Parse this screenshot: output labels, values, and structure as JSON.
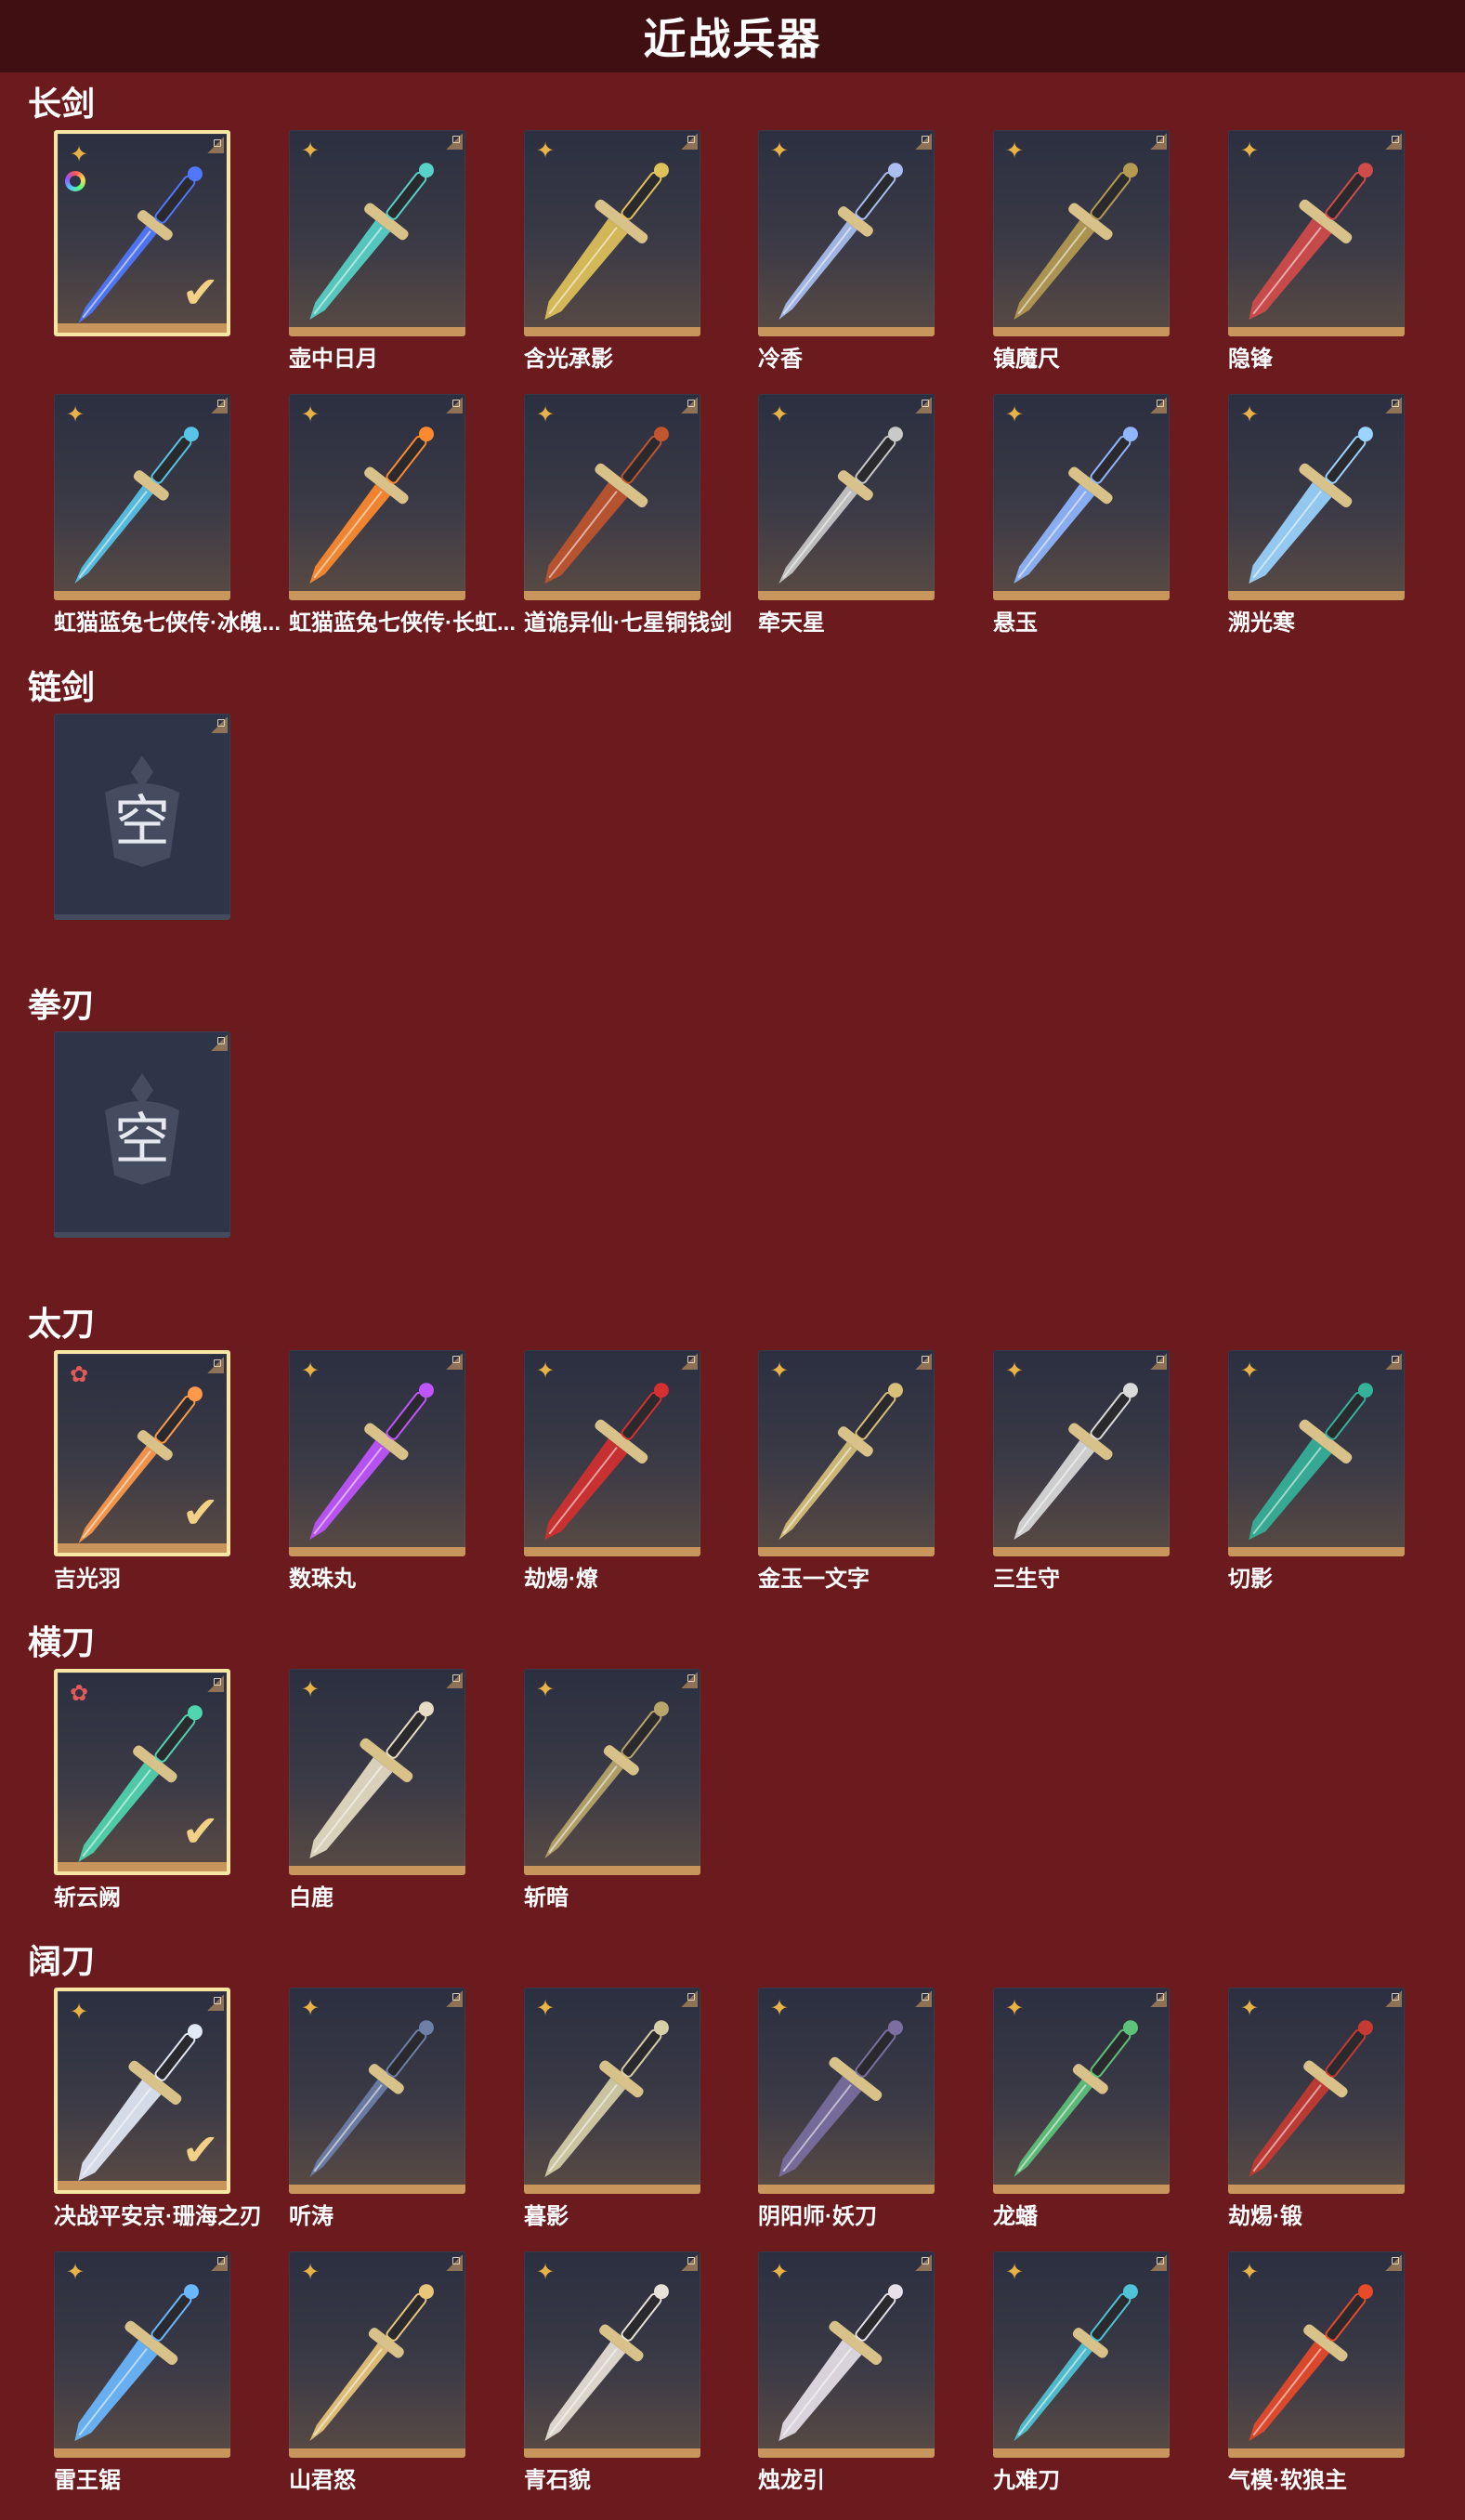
{
  "header": {
    "title": "近战兵器"
  },
  "colors": {
    "background": "#6b1a1d",
    "topbar": "#3f0f12",
    "selected_frame": "#f8e6a5",
    "rarity_gold": "#e8b246",
    "rarity_red": "#e45a5a"
  },
  "empty_glyph": "空",
  "check_glyph": "✔",
  "sections": [
    {
      "title": "长剑",
      "items": [
        {
          "name": "",
          "selected": true,
          "rarity": "gold",
          "icon": "blue-longsword-icon",
          "color": "#4f78ff",
          "badge": "color-ring"
        },
        {
          "name": "壶中日月",
          "icon": "teal-longsword-icon",
          "color": "#58d2c8"
        },
        {
          "name": "含光承影",
          "icon": "gold-longsword-icon",
          "color": "#e0c25a"
        },
        {
          "name": "冷香",
          "icon": "pale-blue-longsword-icon",
          "color": "#a9bff0"
        },
        {
          "name": "镇魔尺",
          "icon": "dark-gold-longsword-icon",
          "color": "#b49a52"
        },
        {
          "name": "隐锋",
          "icon": "crimson-longsword-icon",
          "color": "#d24b4b"
        },
        {
          "name": "虹猫蓝兔七侠传·冰魄...",
          "icon": "ice-longsword-icon",
          "color": "#57c4e8"
        },
        {
          "name": "虹猫蓝兔七侠传·长虹...",
          "icon": "flame-longsword-icon",
          "color": "#ff8a2e"
        },
        {
          "name": "道诡异仙·七星铜钱剑",
          "icon": "coin-sword-icon",
          "color": "#c0552e"
        },
        {
          "name": "牵天星",
          "icon": "silver-longsword-icon",
          "color": "#c9c9c9"
        },
        {
          "name": "悬玉",
          "icon": "jade-blue-longsword-icon",
          "color": "#8fb6ff"
        },
        {
          "name": "溯光寒",
          "icon": "frost-longsword-icon",
          "color": "#9ad4ff"
        }
      ]
    },
    {
      "title": "链剑",
      "items": [
        {
          "name": "",
          "empty": true
        }
      ]
    },
    {
      "title": "拳刃",
      "items": [
        {
          "name": "",
          "empty": true
        }
      ]
    },
    {
      "title": "太刀",
      "items": [
        {
          "name": "吉光羽",
          "selected": true,
          "rarity": "red",
          "icon": "phoenix-katana-icon",
          "color": "#ff9a4a"
        },
        {
          "name": "数珠丸",
          "icon": "violet-katana-icon",
          "color": "#c055ff"
        },
        {
          "name": "劫焬·燎",
          "icon": "black-red-katana-icon",
          "color": "#d43030"
        },
        {
          "name": "金玉一文字",
          "icon": "gold-katana-icon",
          "color": "#d8c07a"
        },
        {
          "name": "三生守",
          "icon": "white-katana-icon",
          "color": "#dadada"
        },
        {
          "name": "切影",
          "icon": "green-katana-icon",
          "color": "#35b29a"
        }
      ]
    },
    {
      "title": "横刀",
      "items": [
        {
          "name": "斩云阙",
          "selected": true,
          "rarity": "red",
          "icon": "jade-heng-dao-icon",
          "color": "#4fd6b0"
        },
        {
          "name": "白鹿",
          "icon": "white-deer-blade-icon",
          "color": "#e6ddc4"
        },
        {
          "name": "斩暗",
          "icon": "bronze-heng-dao-icon",
          "color": "#b9a66a"
        }
      ]
    },
    {
      "title": "阔刀",
      "items": [
        {
          "name": "决战平安京·珊海之刃",
          "selected": true,
          "rarity": "gold",
          "icon": "coral-broadblade-icon",
          "color": "#e2e8f5"
        },
        {
          "name": "听涛",
          "icon": "steel-broadblade-icon",
          "color": "#6e7fa8"
        },
        {
          "name": "暮影",
          "icon": "bone-broadblade-icon",
          "color": "#d6cfa8"
        },
        {
          "name": "阴阳师·妖刀",
          "icon": "yokai-broadblade-icon",
          "color": "#7a6fa0"
        },
        {
          "name": "龙蟠",
          "icon": "dragon-broadblade-icon",
          "color": "#5ec27a"
        },
        {
          "name": "劫焬·锻",
          "icon": "ember-broadblade-icon",
          "color": "#c53a32"
        },
        {
          "name": "雷王锯",
          "icon": "thunder-broadblade-icon",
          "color": "#6ab8ff"
        },
        {
          "name": "山君怒",
          "icon": "tiger-broadblade-icon",
          "color": "#e8c67a"
        },
        {
          "name": "青石貌",
          "icon": "stone-broadblade-icon",
          "color": "#e8e2d8"
        },
        {
          "name": "烛龙引",
          "icon": "candle-dragon-broadblade-icon",
          "color": "#e6e0e8"
        },
        {
          "name": "九难刀",
          "icon": "azure-broadblade-icon",
          "color": "#4fc4d6"
        },
        {
          "name": "气模·软狼主",
          "icon": "wolf-broadblade-icon",
          "color": "#e84a2a"
        }
      ]
    }
  ]
}
